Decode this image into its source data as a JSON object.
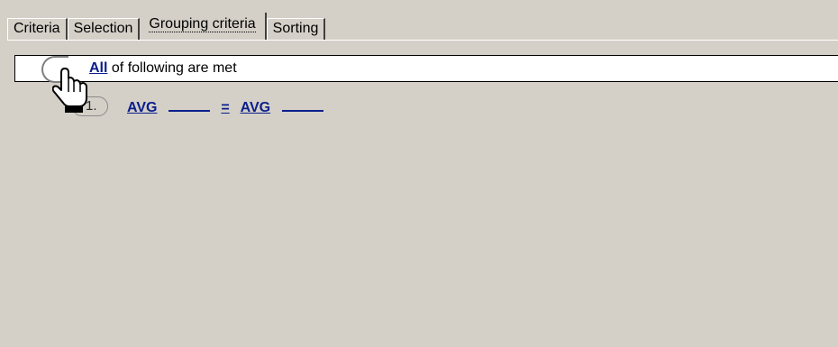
{
  "tabs": [
    {
      "label": "Criteria"
    },
    {
      "label": "Selection"
    },
    {
      "label": "Grouping criteria",
      "active": true
    },
    {
      "label": "Sorting"
    }
  ],
  "root_condition": {
    "quantifier": "All",
    "text": "of following are met"
  },
  "conditions": [
    {
      "number": "1.",
      "left_function": "AVG",
      "left_operand": "____",
      "operator": "=",
      "right_function": "AVG",
      "right_operand": "____"
    }
  ],
  "icons": {
    "cursor": "hand-pointer-icon",
    "group_bracket": "group-bracket-icon"
  },
  "colors": {
    "panel_background": "#d4d0c8",
    "link": "#0a1e8c",
    "row_background": "#ffffff"
  }
}
